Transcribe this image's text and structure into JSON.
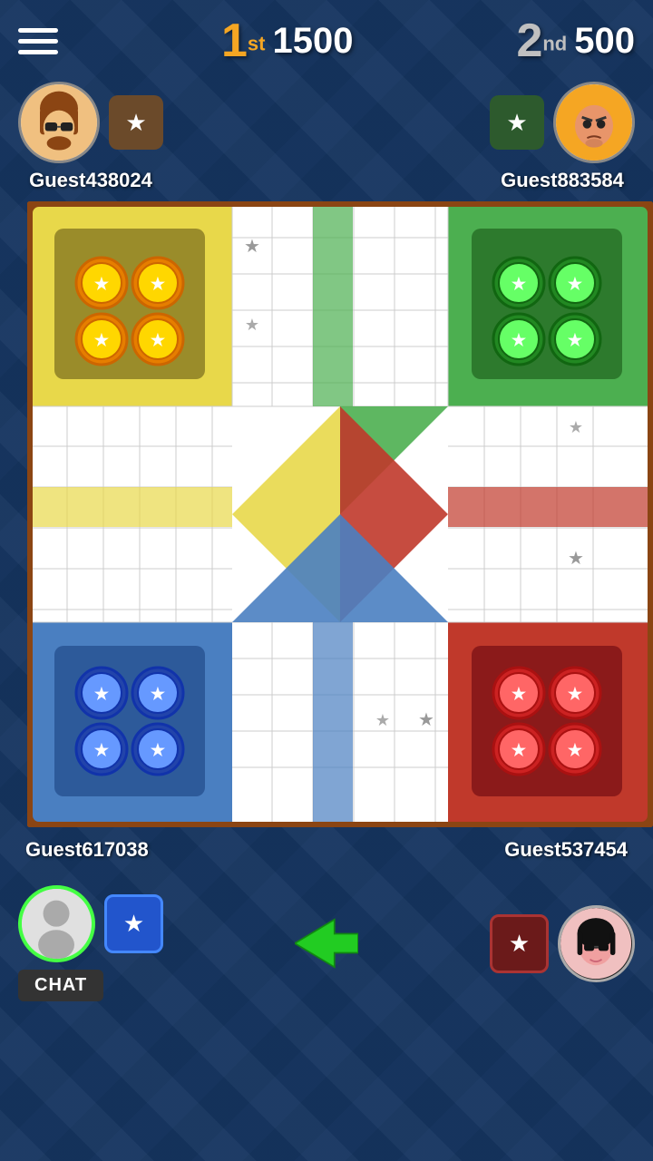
{
  "topbar": {
    "menu_label": "menu",
    "rank1": {
      "number": "1",
      "suffix": "st",
      "score": "1500"
    },
    "rank2": {
      "number": "2",
      "suffix": "nd",
      "score": "500"
    }
  },
  "players": {
    "top_left": {
      "name": "Guest438024",
      "badge": "★"
    },
    "top_right": {
      "name": "Guest883584",
      "badge": "★"
    },
    "bottom_left": {
      "name": "Guest617038",
      "badge": "★",
      "chat": "CHAT"
    },
    "bottom_right": {
      "name": "Guest537454",
      "badge": "★"
    }
  },
  "board": {
    "yellow_tokens": 4,
    "green_tokens": 4,
    "blue_tokens": 4,
    "red_tokens": 4
  },
  "colors": {
    "yellow": "#e8d84a",
    "green": "#4caf50",
    "blue": "#4a7fc1",
    "red": "#c0392b",
    "yellow_dark": "#9a8c2a",
    "green_dark": "#2d7a2d",
    "blue_dark": "#2d5a9a",
    "red_dark": "#8b1a1a"
  }
}
